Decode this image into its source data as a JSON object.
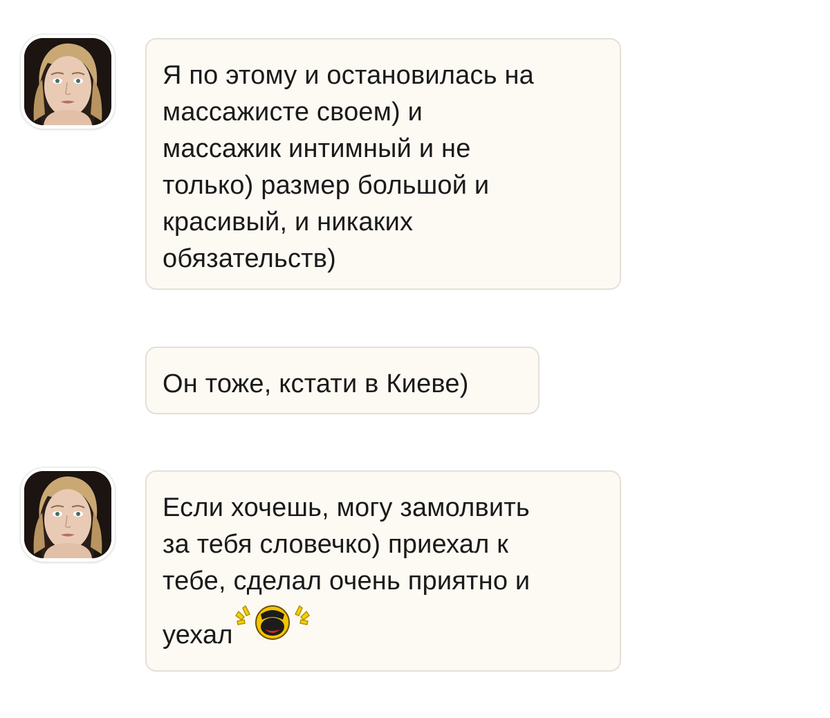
{
  "messages": [
    {
      "lines": [
        "Я по этому и остановилась на",
        "массажисте своем) и",
        "массажик интимный и не",
        "только) размер большой и",
        "красивый, и никаких",
        "обязательств)"
      ]
    },
    {
      "lines": [
        "Он тоже, кстати в Киеве)"
      ]
    },
    {
      "lines": [
        "Если хочешь, могу замолвить",
        "за тебя словечко) приехал к",
        "тебе, сделал очень приятно и",
        "уехал"
      ],
      "emoji": "laughing-face-emoji"
    }
  ],
  "colors": {
    "bubble_bg": "#fdfaf3",
    "bubble_border": "#e3e0d8",
    "text": "#1a1a1a"
  }
}
